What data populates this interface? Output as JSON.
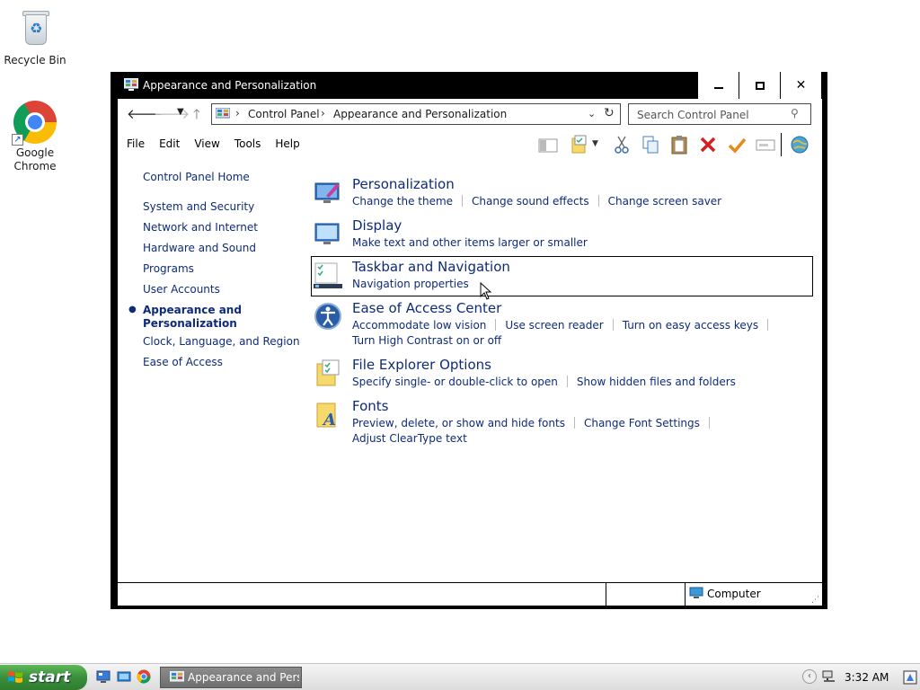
{
  "desktop": {
    "icons": [
      {
        "label": "Recycle Bin"
      },
      {
        "label": "Google Chrome"
      }
    ]
  },
  "window": {
    "title": "Appearance and Personalization",
    "buttons": {
      "minimize": "minimize",
      "maximize": "maximize",
      "close": "✕"
    }
  },
  "address": {
    "crumbs": [
      "Control Panel",
      "Appearance and Personalization"
    ],
    "separator": "›"
  },
  "search": {
    "placeholder": "Search Control Panel"
  },
  "menu": [
    "File",
    "Edit",
    "View",
    "Tools",
    "Help"
  ],
  "leftnav": {
    "home": "Control Panel Home",
    "items": [
      "System and Security",
      "Network and Internet",
      "Hardware and Sound",
      "Programs",
      "User Accounts",
      "Appearance and Personalization",
      "Clock, Language, and Region",
      "Ease of Access"
    ],
    "active_index": 5
  },
  "categories": [
    {
      "title": "Personalization",
      "links": [
        "Change the theme",
        "Change sound effects",
        "Change screen saver"
      ]
    },
    {
      "title": "Display",
      "links": [
        "Make text and other items larger or smaller"
      ]
    },
    {
      "title": "Taskbar and Navigation",
      "links": [
        "Navigation properties"
      ]
    },
    {
      "title": "Ease of Access Center",
      "links": [
        "Accommodate low vision",
        "Use screen reader",
        "Turn on easy access keys",
        "Turn High Contrast on or off"
      ]
    },
    {
      "title": "File Explorer Options",
      "links": [
        "Specify single- or double-click to open",
        "Show hidden files and folders"
      ]
    },
    {
      "title": "Fonts",
      "links": [
        "Preview, delete, or show and hide fonts",
        "Change Font Settings",
        "Adjust ClearType text"
      ]
    }
  ],
  "statusbar": {
    "location": "Computer"
  },
  "taskbar": {
    "start": "start",
    "task": "Appearance and Perso...",
    "clock": "3:32 AM"
  }
}
